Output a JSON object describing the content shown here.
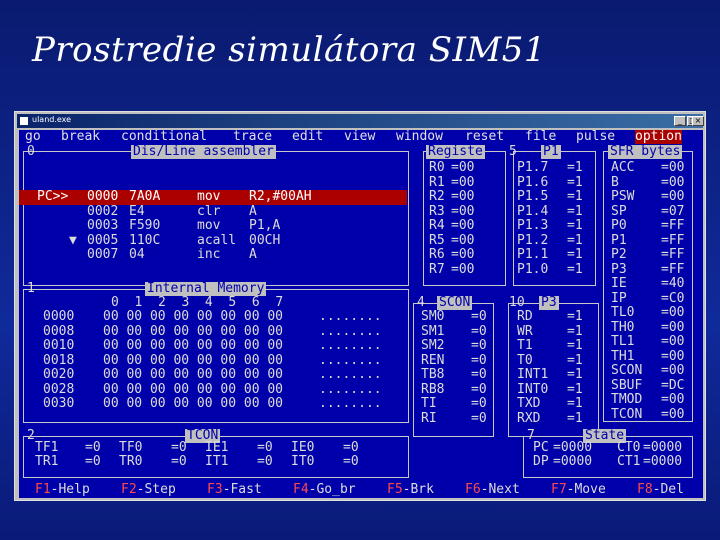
{
  "slide": {
    "title": "Prostredie simulátora SIM51"
  },
  "window": {
    "title": "uland.exe",
    "min": "_",
    "max": "□",
    "close": "×"
  },
  "menu": [
    "go",
    "break",
    "conditional",
    "trace",
    "edit",
    "view",
    "window",
    "reset",
    "file",
    "pulse",
    "option"
  ],
  "panels": {
    "dis": {
      "num": "0",
      "title": "Dis/Line assembler"
    },
    "regs": {
      "title": "Registe"
    },
    "p1": {
      "num": "5",
      "title": "P1"
    },
    "sfr": {
      "title": "SFR bytes"
    },
    "mem": {
      "num": "1",
      "title": "Internal Memory"
    },
    "scon": {
      "num": "4",
      "title": "SCON"
    },
    "p3": {
      "num": "10",
      "title": "P3"
    },
    "tcon": {
      "num": "2",
      "title": "TCON"
    },
    "state": {
      "num": "7",
      "title": "State"
    }
  },
  "disasm": [
    {
      "pc": "PC>>",
      "addr": "0000",
      "code": "7A0A",
      "mn": "mov",
      "op": "R2,#00AH"
    },
    {
      "pc": "",
      "addr": "0002",
      "code": "E4",
      "mn": "clr",
      "op": "A"
    },
    {
      "pc": "",
      "addr": "0003",
      "code": "F590",
      "mn": "mov",
      "op": "P1,A"
    },
    {
      "pc": "▼",
      "addr": "0005",
      "code": "110C",
      "mn": "acall",
      "op": "00CH"
    },
    {
      "pc": "",
      "addr": "0007",
      "code": "04",
      "mn": "inc",
      "op": "A"
    }
  ],
  "registers": [
    {
      "n": "R0",
      "v": "=00"
    },
    {
      "n": "R1",
      "v": "=00"
    },
    {
      "n": "R2",
      "v": "=00"
    },
    {
      "n": "R3",
      "v": "=00"
    },
    {
      "n": "R4",
      "v": "=00"
    },
    {
      "n": "R5",
      "v": "=00"
    },
    {
      "n": "R6",
      "v": "=00"
    },
    {
      "n": "R7",
      "v": "=00"
    }
  ],
  "p1bits": [
    {
      "n": "P1.7",
      "v": "=1"
    },
    {
      "n": "P1.6",
      "v": "=1"
    },
    {
      "n": "P1.5",
      "v": "=1"
    },
    {
      "n": "P1.4",
      "v": "=1"
    },
    {
      "n": "P1.3",
      "v": "=1"
    },
    {
      "n": "P1.2",
      "v": "=1"
    },
    {
      "n": "P1.1",
      "v": "=1"
    },
    {
      "n": "P1.0",
      "v": "=1"
    }
  ],
  "sfr": [
    {
      "n": "ACC",
      "v": "=00"
    },
    {
      "n": "B",
      "v": "=00"
    },
    {
      "n": "PSW",
      "v": "=00"
    },
    {
      "n": "SP",
      "v": "=07"
    },
    {
      "n": "P0",
      "v": "=FF"
    },
    {
      "n": "P1",
      "v": "=FF"
    },
    {
      "n": "P2",
      "v": "=FF"
    },
    {
      "n": "P3",
      "v": "=FF"
    },
    {
      "n": "IE",
      "v": "=40"
    },
    {
      "n": "IP",
      "v": "=C0"
    },
    {
      "n": "TL0",
      "v": "=00"
    },
    {
      "n": "TH0",
      "v": "=00"
    },
    {
      "n": "TL1",
      "v": "=00"
    },
    {
      "n": "TH1",
      "v": "=00"
    },
    {
      "n": "SCON",
      "v": "=00"
    },
    {
      "n": "SBUF",
      "v": "=DC"
    },
    {
      "n": "TMOD",
      "v": "=00"
    },
    {
      "n": "TCON",
      "v": "=00"
    }
  ],
  "memory": {
    "header": "0  1  2  3  4  5  6  7",
    "rows": [
      {
        "a": "0000",
        "b": "00 00 00 00 00 00 00 00",
        "c": "........"
      },
      {
        "a": "0008",
        "b": "00 00 00 00 00 00 00 00",
        "c": "........"
      },
      {
        "a": "0010",
        "b": "00 00 00 00 00 00 00 00",
        "c": "........"
      },
      {
        "a": "0018",
        "b": "00 00 00 00 00 00 00 00",
        "c": "........"
      },
      {
        "a": "0020",
        "b": "00 00 00 00 00 00 00 00",
        "c": "........"
      },
      {
        "a": "0028",
        "b": "00 00 00 00 00 00 00 00",
        "c": "........"
      },
      {
        "a": "0030",
        "b": "00 00 00 00 00 00 00 00",
        "c": "........"
      }
    ]
  },
  "scon": [
    {
      "n": "SM0",
      "v": "=0"
    },
    {
      "n": "SM1",
      "v": "=0"
    },
    {
      "n": "SM2",
      "v": "=0"
    },
    {
      "n": "REN",
      "v": "=0"
    },
    {
      "n": "TB8",
      "v": "=0"
    },
    {
      "n": "RB8",
      "v": "=0"
    },
    {
      "n": "TI",
      "v": "=0"
    },
    {
      "n": "RI",
      "v": "=0"
    }
  ],
  "p3bits": [
    {
      "n": "RD",
      "v": "=1"
    },
    {
      "n": "WR",
      "v": "=1"
    },
    {
      "n": "T1",
      "v": "=1"
    },
    {
      "n": "T0",
      "v": "=1"
    },
    {
      "n": "INT1",
      "v": "=1"
    },
    {
      "n": "INT0",
      "v": "=1"
    },
    {
      "n": "TXD",
      "v": "=1"
    },
    {
      "n": "RXD",
      "v": "=1"
    }
  ],
  "tcon": [
    [
      {
        "n": "TF1",
        "v": "=0"
      },
      {
        "n": "TF0",
        "v": "=0"
      },
      {
        "n": "IE1",
        "v": "=0"
      },
      {
        "n": "IE0",
        "v": "=0"
      }
    ],
    [
      {
        "n": "TR1",
        "v": "=0"
      },
      {
        "n": "TR0",
        "v": "=0"
      },
      {
        "n": "IT1",
        "v": "=0"
      },
      {
        "n": "IT0",
        "v": "=0"
      }
    ]
  ],
  "state": [
    {
      "a": "PC",
      "av": "=0000",
      "b": "CT0",
      "bv": "=0000"
    },
    {
      "a": "DP",
      "av": "=0000",
      "b": "CT1",
      "bv": "=0000"
    }
  ],
  "fkeys": [
    {
      "k": "F1",
      "l": "-Help"
    },
    {
      "k": "F2",
      "l": "-Step"
    },
    {
      "k": "F3",
      "l": "-Fast"
    },
    {
      "k": "F4",
      "l": "-Go_br"
    },
    {
      "k": "F5",
      "l": "-Brk"
    },
    {
      "k": "F6",
      "l": "-Next"
    },
    {
      "k": "F7",
      "l": "-Move"
    },
    {
      "k": "F8",
      "l": "-Del"
    }
  ],
  "colors": {
    "screen": "#0000aa",
    "highlight": "#aa0000",
    "fkey": "#ff4a4a"
  }
}
